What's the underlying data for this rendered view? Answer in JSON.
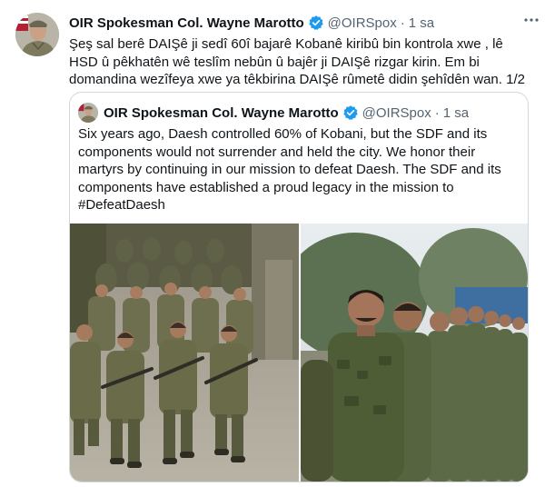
{
  "tweet": {
    "author_name": "OIR Spokesman Col. Wayne Marotto",
    "handle": "@OIRSpox",
    "separator": "·",
    "time": "1 sa",
    "more_icon": "more-horizontal-icon",
    "text": "Şeş sal berê DAIŞê ji sedî 60î  bajarê Kobanê kiribû bin kontrola xwe , lê HSD û pêkhatên wê teslîm nebûn û bajêr ji DAIŞê rizgar kirin.  Em bi domandina wezîfeya xwe ya têkbirina DAIŞê rûmetê didin şehîdên wan. 1/2"
  },
  "quote": {
    "author_name": "OIR Spokesman Col. Wayne Marotto",
    "handle": "@OIRSpox",
    "separator": "·",
    "time": "1 sa",
    "text": "Six years ago, Daesh controlled 60% of Kobani, but the SDF and its components would not surrender and held the city. We honor their martyrs by continuing in our mission to defeat Daesh. The SDF and its components have established a proud legacy in the mission to #DefeatDaesh"
  },
  "colors": {
    "verified_badge": "#1d9bf0",
    "border": "#cfd9de",
    "secondary_text": "#536471"
  }
}
